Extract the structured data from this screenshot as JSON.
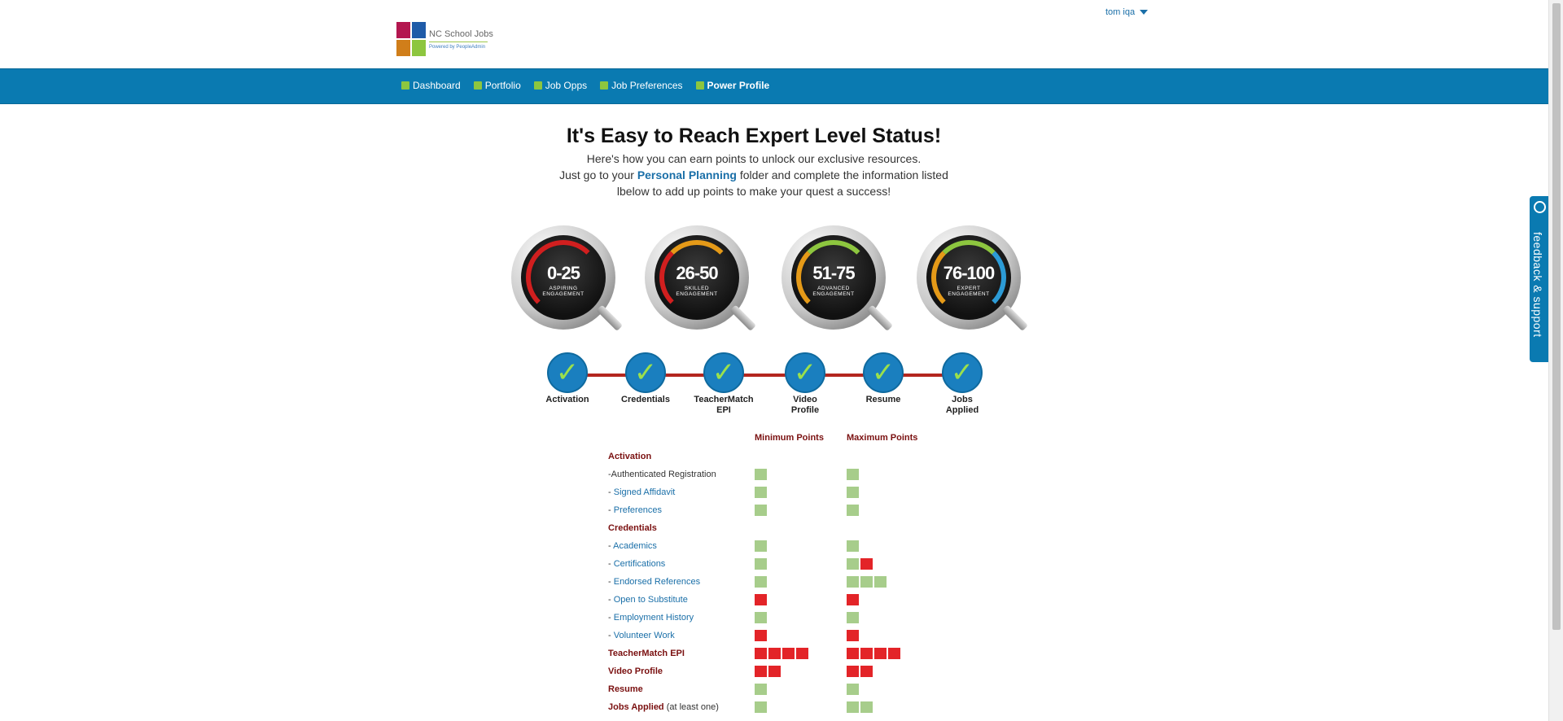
{
  "header": {
    "logo_name": "NC School Jobs",
    "logo_sub": "Powered by PeopleAdmin",
    "user": "tom iqa"
  },
  "nav": {
    "items": [
      {
        "label": "Dashboard"
      },
      {
        "label": "Portfolio"
      },
      {
        "label": "Job Opps"
      },
      {
        "label": "Job Preferences"
      },
      {
        "label": "Power Profile",
        "active": true
      }
    ]
  },
  "hero": {
    "title": "It's Easy to Reach Expert Level Status!",
    "line1": "Here's how you can earn points to unlock our exclusive resources.",
    "line2_pre": "Just go to your ",
    "line2_link": "Personal Planning",
    "line2_post": " folder and complete the information listed",
    "line3": "lbelow to add up points to make your quest a success!"
  },
  "gauges": [
    {
      "range": "0-25",
      "caption_1": "ASPIRING",
      "caption_2": "ENGAGEMENT",
      "arc_color": "#d11f1f"
    },
    {
      "range": "26-50",
      "caption_1": "SKILLED",
      "caption_2": "ENGAGEMENT",
      "arc_color": "#e59a18"
    },
    {
      "range": "51-75",
      "caption_1": "ADVANCED",
      "caption_2": "ENGAGEMENT",
      "arc_color": "#8dc63f"
    },
    {
      "range": "76-100",
      "caption_1": "EXPERT",
      "caption_2": "ENGAGEMENT",
      "arc_color": "#2c9bd6"
    }
  ],
  "steps": [
    {
      "label_1": "Activation",
      "label_2": ""
    },
    {
      "label_1": "Credentials",
      "label_2": ""
    },
    {
      "label_1": "TeacherMatch",
      "label_2": "EPI"
    },
    {
      "label_1": "Video",
      "label_2": "Profile"
    },
    {
      "label_1": "Resume",
      "label_2": ""
    },
    {
      "label_1": "Jobs",
      "label_2": "Applied"
    }
  ],
  "table": {
    "min_header": "Minimum Points",
    "max_header": "Maximum Points",
    "rows": [
      {
        "label": "Activation",
        "type": "section",
        "min": "",
        "max": ""
      },
      {
        "label": "-Authenticated Registration",
        "type": "plain",
        "min": "g",
        "max": "g"
      },
      {
        "label": "Signed Affidavit",
        "type": "link",
        "min": "g",
        "max": "g"
      },
      {
        "label": "Preferences",
        "type": "link",
        "min": "g",
        "max": "g"
      },
      {
        "label": "Credentials",
        "type": "section",
        "min": "",
        "max": ""
      },
      {
        "label": "Academics",
        "type": "link",
        "min": "g",
        "max": "g"
      },
      {
        "label": "Certifications",
        "type": "link",
        "min": "g",
        "max": "gr"
      },
      {
        "label": "Endorsed References",
        "type": "link",
        "min": "g",
        "max": "ggg"
      },
      {
        "label": "Open to Substitute",
        "type": "link",
        "min": "r",
        "max": "r"
      },
      {
        "label": "Employment History",
        "type": "link",
        "min": "g",
        "max": "g"
      },
      {
        "label": "Volunteer Work",
        "type": "link",
        "min": "r",
        "max": "r"
      },
      {
        "label": "TeacherMatch EPI",
        "type": "section",
        "min": "rrrr",
        "max": "rrrr"
      },
      {
        "label": "Video Profile",
        "type": "section",
        "min": "rr",
        "max": "rr"
      },
      {
        "label": "Resume",
        "type": "section",
        "min": "g",
        "max": "g"
      },
      {
        "label": "Jobs Applied",
        "type": "section",
        "note": " (at least one)",
        "min": "g",
        "max": "gg"
      }
    ]
  },
  "feedback": {
    "label": "feedback & support"
  },
  "colors": {
    "nav_bg": "#0a7ab1",
    "accent_green": "#8dc63f",
    "point_green": "#a7cd8b",
    "point_red": "#e32428",
    "section_red": "#7a1010"
  }
}
